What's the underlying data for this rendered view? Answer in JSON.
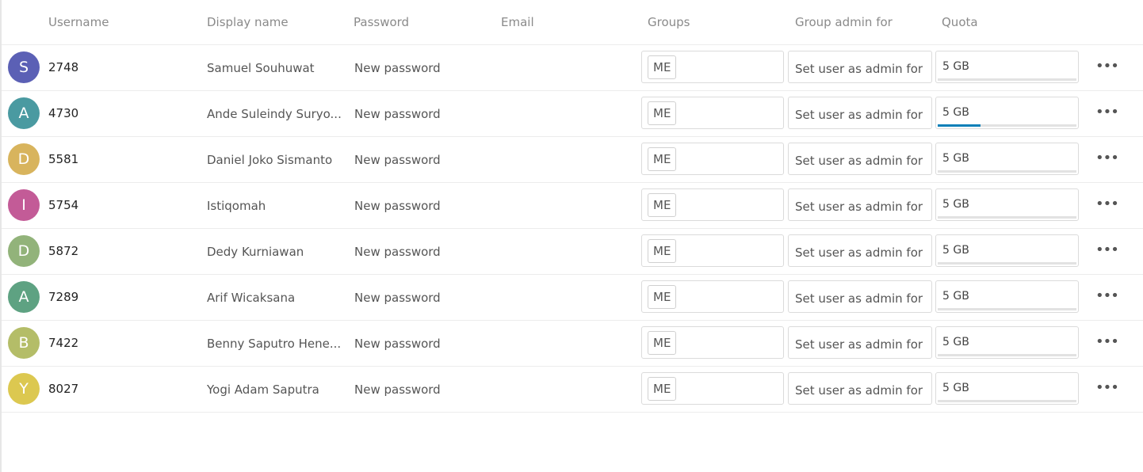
{
  "columns": {
    "username": "Username",
    "display_name": "Display name",
    "password": "Password",
    "email": "Email",
    "groups": "Groups",
    "group_admin": "Group admin for",
    "quota": "Quota"
  },
  "users": [
    {
      "initial": "S",
      "avatar_color": "#5b60b5",
      "username": "2748",
      "display_name": "Samuel Souhuwat",
      "password_placeholder": "New password",
      "email": "",
      "group": "ME",
      "admin_placeholder": "Set user as admin for",
      "quota": "5 GB",
      "quota_used": 0.0
    },
    {
      "initial": "A",
      "avatar_color": "#4a9aa1",
      "username": "4730",
      "display_name": "Ande Suleindy Suryo...",
      "password_placeholder": "New password",
      "email": "",
      "group": "ME",
      "admin_placeholder": "Set user as admin for",
      "quota": "5 GB",
      "quota_used": 0.31
    },
    {
      "initial": "D",
      "avatar_color": "#d8b45d",
      "username": "5581",
      "display_name": "Daniel Joko Sismanto",
      "password_placeholder": "New password",
      "email": "",
      "group": "ME",
      "admin_placeholder": "Set user as admin for",
      "quota": "5 GB",
      "quota_used": 0.0
    },
    {
      "initial": "I",
      "avatar_color": "#c35b97",
      "username": "5754",
      "display_name": "Istiqomah",
      "password_placeholder": "New password",
      "email": "",
      "group": "ME",
      "admin_placeholder": "Set user as admin for",
      "quota": "5 GB",
      "quota_used": 0.0
    },
    {
      "initial": "D",
      "avatar_color": "#92b37a",
      "username": "5872",
      "display_name": "Dedy Kurniawan",
      "password_placeholder": "New password",
      "email": "",
      "group": "ME",
      "admin_placeholder": "Set user as admin for",
      "quota": "5 GB",
      "quota_used": 0.0
    },
    {
      "initial": "A",
      "avatar_color": "#5ea282",
      "username": "7289",
      "display_name": "Arif Wicaksana",
      "password_placeholder": "New password",
      "email": "",
      "group": "ME",
      "admin_placeholder": "Set user as admin for",
      "quota": "5 GB",
      "quota_used": 0.0
    },
    {
      "initial": "B",
      "avatar_color": "#b4bd68",
      "username": "7422",
      "display_name": "Benny Saputro Hene...",
      "password_placeholder": "New password",
      "email": "",
      "group": "ME",
      "admin_placeholder": "Set user as admin for",
      "quota": "5 GB",
      "quota_used": 0.0
    },
    {
      "initial": "Y",
      "avatar_color": "#dcc850",
      "username": "8027",
      "display_name": "Yogi Adam Saputra",
      "password_placeholder": "New password",
      "email": "",
      "group": "ME",
      "admin_placeholder": "Set user as admin for",
      "quota": "5 GB",
      "quota_used": 0.0
    }
  ],
  "icons": {
    "more": "more-horizontal-icon"
  }
}
